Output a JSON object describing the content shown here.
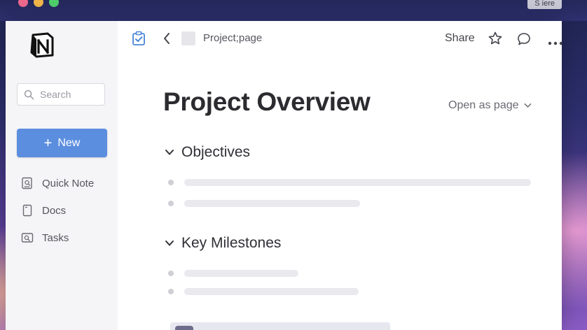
{
  "desktop": {
    "share_badge": "S iere",
    "traffic_colors": [
      "#ee6a8e",
      "#f2b64a",
      "#4fcf6b"
    ]
  },
  "sidebar": {
    "logo_icon": "notion-logo",
    "search_placeholder": "Search",
    "new_button_label": "New",
    "new_button_color": "#5c8ee0",
    "items": [
      {
        "label": "Quick Note",
        "icon": "note-icon"
      },
      {
        "label": "Docs",
        "icon": "doc-icon"
      },
      {
        "label": "Tasks",
        "icon": "tasks-icon"
      }
    ]
  },
  "toolbar": {
    "breadcrumb": "Project;page",
    "share_label": "Share"
  },
  "page": {
    "title": "Project Overview",
    "open_as_label": "Open as page",
    "sections": [
      {
        "heading": "Objectives"
      },
      {
        "heading": "Key Milestones"
      }
    ]
  }
}
